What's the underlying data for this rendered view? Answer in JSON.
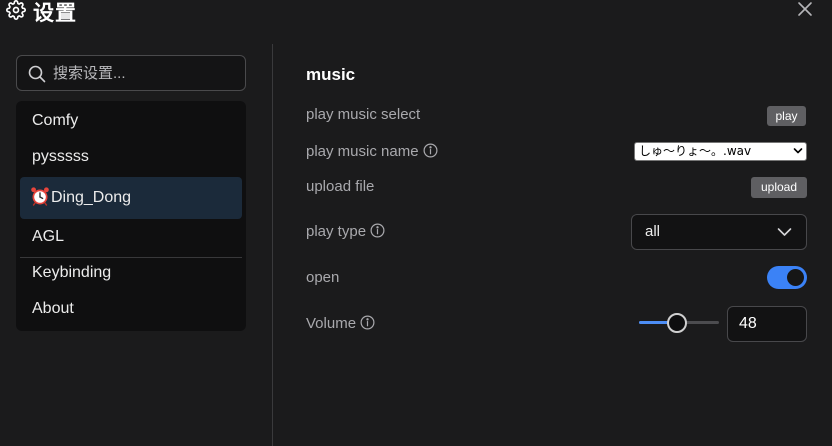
{
  "header": {
    "title": "设置",
    "icon": "gear-icon",
    "close_icon": "close-icon"
  },
  "sidebar": {
    "search_placeholder": "搜索设置...",
    "items": [
      {
        "label": "Comfy",
        "active": false
      },
      {
        "label": "pysssss",
        "active": false
      },
      {
        "label": "Ding_Dong",
        "active": true,
        "icon": "alarm-clock-icon"
      },
      {
        "label": "AGL",
        "active": false
      },
      {
        "label": "Keybinding",
        "active": false
      },
      {
        "label": "About",
        "active": false
      }
    ]
  },
  "main": {
    "section_title": "music",
    "settings": {
      "play_music_select": {
        "label": "play music select",
        "button": "play"
      },
      "play_music_name": {
        "label": "play music name",
        "value": "しゅ〜りょ〜。.wav"
      },
      "upload_file": {
        "label": "upload file",
        "button": "upload"
      },
      "play_type": {
        "label": "play type",
        "value": "all"
      },
      "open": {
        "label": "open",
        "enabled": true
      },
      "volume": {
        "label": "Volume",
        "value": "48",
        "max": 100
      }
    }
  },
  "colors": {
    "accent": "#3b82f6",
    "background": "#1b1b1c",
    "active_item": "#1b2a3a"
  }
}
